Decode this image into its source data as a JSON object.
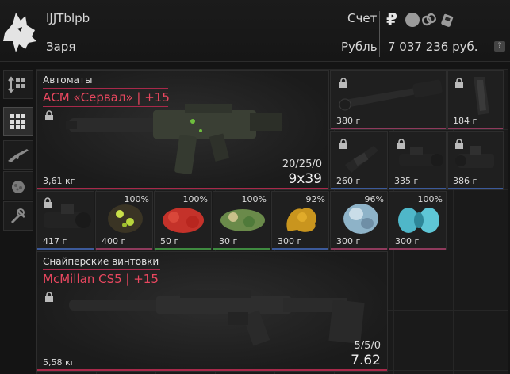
{
  "header": {
    "username": "IJJTblpb",
    "character": "Заря",
    "account_label": "Счет",
    "currency_label": "Рубль",
    "money": "7 037 236 руб.",
    "ruble_symbol": "₽",
    "help_symbol": "?"
  },
  "toolbar": [
    {
      "name": "sort-tool",
      "icon": "sort-icon",
      "active": false
    },
    {
      "name": "grid-view-tool",
      "icon": "grid-icon",
      "active": true
    },
    {
      "name": "weapons-filter",
      "icon": "rifle-icon",
      "active": false
    },
    {
      "name": "grenades-filter",
      "icon": "grenade-icon",
      "active": false
    },
    {
      "name": "tools-filter",
      "icon": "wrench-icon",
      "active": false
    }
  ],
  "weapon1": {
    "category": "Автоматы",
    "name": "АСМ «Сервал» | +15",
    "weight": "3,61 кг",
    "ammo": "20/25/0",
    "caliber": "9x39"
  },
  "weapon2": {
    "category": "Снайперские винтовки",
    "name": "McMillan CS5 | +15",
    "weight": "5,58 кг",
    "ammo": "5/5/0",
    "caliber": "7.62"
  },
  "top_items": [
    {
      "name": "scope",
      "weight": "380 г"
    },
    {
      "name": "magazine",
      "weight": "184 г"
    },
    {
      "name": "mount",
      "weight": "260 г"
    },
    {
      "name": "night-scope",
      "weight": "335 г"
    },
    {
      "name": "collimator",
      "weight": "386 г"
    }
  ],
  "row_items": [
    {
      "name": "thermal-scope",
      "weight": "417 г",
      "percent": ""
    },
    {
      "name": "artifact-green",
      "weight": "400 г",
      "percent": "100%"
    },
    {
      "name": "artifact-red",
      "weight": "50 г",
      "percent": "100%"
    },
    {
      "name": "artifact-moss",
      "weight": "30 г",
      "percent": "100%"
    },
    {
      "name": "artifact-yellow",
      "weight": "300 г",
      "percent": "92%"
    },
    {
      "name": "artifact-crystal",
      "weight": "300 г",
      "percent": "96%"
    },
    {
      "name": "artifact-cyan",
      "weight": "300 г",
      "percent": "100%"
    }
  ],
  "colors": {
    "accent_red": "#e8475f",
    "rarity_red": "#a8294a",
    "rarity_blue": "#3c5a9a",
    "rarity_green": "#3f8a40"
  }
}
